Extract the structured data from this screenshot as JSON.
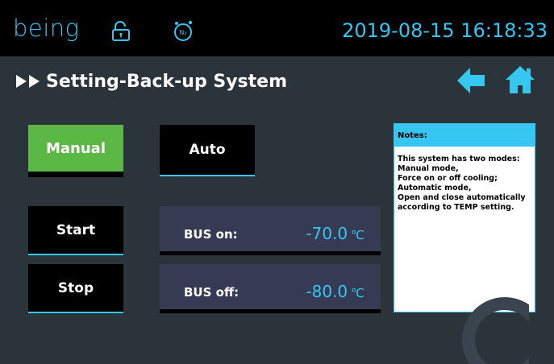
{
  "header": {
    "logo": "being",
    "datetime": "2019-08-15 16:18:33",
    "lock_icon": "lock-open-icon",
    "n2_icon": "nitrogen-alarm-icon",
    "n2_text": "N₂"
  },
  "title": {
    "text": "Setting-Back-up System",
    "back_icon": "back-arrow-icon",
    "home_icon": "home-icon"
  },
  "mode": {
    "manual_label": "Manual",
    "auto_label": "Auto",
    "active": "Manual",
    "active_color": "#5cb845"
  },
  "controls": {
    "start_label": "Start",
    "stop_label": "Stop"
  },
  "readings": {
    "bus_on_label": "BUS on:",
    "bus_on_value": "-70.0",
    "bus_off_label": "BUS off:",
    "bus_off_value": "-80.0",
    "unit": "℃"
  },
  "notes": {
    "title": "Notes:",
    "body": "This system has two modes:\nManual mode,\nForce on or off cooling;\nAutomatic mode,\nOpen and close automatically according to TEMP setting."
  },
  "colors": {
    "accent": "#35c6f1",
    "background": "#2b333b",
    "panel": "#363a53"
  }
}
